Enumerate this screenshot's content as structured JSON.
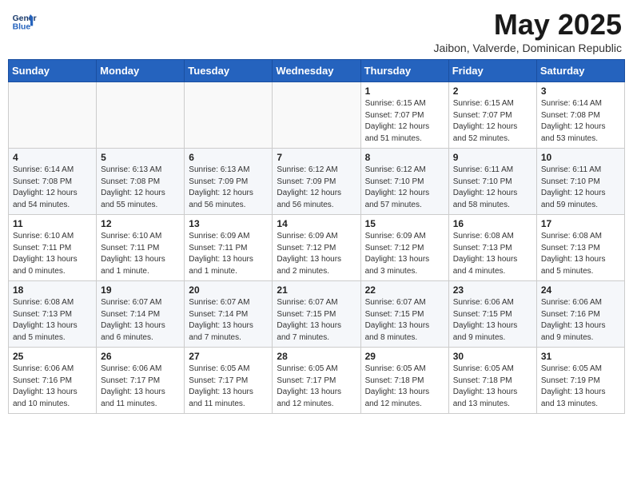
{
  "header": {
    "logo_line1": "General",
    "logo_line2": "Blue",
    "month_title": "May 2025",
    "subtitle": "Jaibon, Valverde, Dominican Republic"
  },
  "weekdays": [
    "Sunday",
    "Monday",
    "Tuesday",
    "Wednesday",
    "Thursday",
    "Friday",
    "Saturday"
  ],
  "weeks": [
    [
      {
        "day": "",
        "info": ""
      },
      {
        "day": "",
        "info": ""
      },
      {
        "day": "",
        "info": ""
      },
      {
        "day": "",
        "info": ""
      },
      {
        "day": "1",
        "info": "Sunrise: 6:15 AM\nSunset: 7:07 PM\nDaylight: 12 hours\nand 51 minutes."
      },
      {
        "day": "2",
        "info": "Sunrise: 6:15 AM\nSunset: 7:07 PM\nDaylight: 12 hours\nand 52 minutes."
      },
      {
        "day": "3",
        "info": "Sunrise: 6:14 AM\nSunset: 7:08 PM\nDaylight: 12 hours\nand 53 minutes."
      }
    ],
    [
      {
        "day": "4",
        "info": "Sunrise: 6:14 AM\nSunset: 7:08 PM\nDaylight: 12 hours\nand 54 minutes."
      },
      {
        "day": "5",
        "info": "Sunrise: 6:13 AM\nSunset: 7:08 PM\nDaylight: 12 hours\nand 55 minutes."
      },
      {
        "day": "6",
        "info": "Sunrise: 6:13 AM\nSunset: 7:09 PM\nDaylight: 12 hours\nand 56 minutes."
      },
      {
        "day": "7",
        "info": "Sunrise: 6:12 AM\nSunset: 7:09 PM\nDaylight: 12 hours\nand 56 minutes."
      },
      {
        "day": "8",
        "info": "Sunrise: 6:12 AM\nSunset: 7:10 PM\nDaylight: 12 hours\nand 57 minutes."
      },
      {
        "day": "9",
        "info": "Sunrise: 6:11 AM\nSunset: 7:10 PM\nDaylight: 12 hours\nand 58 minutes."
      },
      {
        "day": "10",
        "info": "Sunrise: 6:11 AM\nSunset: 7:10 PM\nDaylight: 12 hours\nand 59 minutes."
      }
    ],
    [
      {
        "day": "11",
        "info": "Sunrise: 6:10 AM\nSunset: 7:11 PM\nDaylight: 13 hours\nand 0 minutes."
      },
      {
        "day": "12",
        "info": "Sunrise: 6:10 AM\nSunset: 7:11 PM\nDaylight: 13 hours\nand 1 minute."
      },
      {
        "day": "13",
        "info": "Sunrise: 6:09 AM\nSunset: 7:11 PM\nDaylight: 13 hours\nand 1 minute."
      },
      {
        "day": "14",
        "info": "Sunrise: 6:09 AM\nSunset: 7:12 PM\nDaylight: 13 hours\nand 2 minutes."
      },
      {
        "day": "15",
        "info": "Sunrise: 6:09 AM\nSunset: 7:12 PM\nDaylight: 13 hours\nand 3 minutes."
      },
      {
        "day": "16",
        "info": "Sunrise: 6:08 AM\nSunset: 7:13 PM\nDaylight: 13 hours\nand 4 minutes."
      },
      {
        "day": "17",
        "info": "Sunrise: 6:08 AM\nSunset: 7:13 PM\nDaylight: 13 hours\nand 5 minutes."
      }
    ],
    [
      {
        "day": "18",
        "info": "Sunrise: 6:08 AM\nSunset: 7:13 PM\nDaylight: 13 hours\nand 5 minutes."
      },
      {
        "day": "19",
        "info": "Sunrise: 6:07 AM\nSunset: 7:14 PM\nDaylight: 13 hours\nand 6 minutes."
      },
      {
        "day": "20",
        "info": "Sunrise: 6:07 AM\nSunset: 7:14 PM\nDaylight: 13 hours\nand 7 minutes."
      },
      {
        "day": "21",
        "info": "Sunrise: 6:07 AM\nSunset: 7:15 PM\nDaylight: 13 hours\nand 7 minutes."
      },
      {
        "day": "22",
        "info": "Sunrise: 6:07 AM\nSunset: 7:15 PM\nDaylight: 13 hours\nand 8 minutes."
      },
      {
        "day": "23",
        "info": "Sunrise: 6:06 AM\nSunset: 7:15 PM\nDaylight: 13 hours\nand 9 minutes."
      },
      {
        "day": "24",
        "info": "Sunrise: 6:06 AM\nSunset: 7:16 PM\nDaylight: 13 hours\nand 9 minutes."
      }
    ],
    [
      {
        "day": "25",
        "info": "Sunrise: 6:06 AM\nSunset: 7:16 PM\nDaylight: 13 hours\nand 10 minutes."
      },
      {
        "day": "26",
        "info": "Sunrise: 6:06 AM\nSunset: 7:17 PM\nDaylight: 13 hours\nand 11 minutes."
      },
      {
        "day": "27",
        "info": "Sunrise: 6:05 AM\nSunset: 7:17 PM\nDaylight: 13 hours\nand 11 minutes."
      },
      {
        "day": "28",
        "info": "Sunrise: 6:05 AM\nSunset: 7:17 PM\nDaylight: 13 hours\nand 12 minutes."
      },
      {
        "day": "29",
        "info": "Sunrise: 6:05 AM\nSunset: 7:18 PM\nDaylight: 13 hours\nand 12 minutes."
      },
      {
        "day": "30",
        "info": "Sunrise: 6:05 AM\nSunset: 7:18 PM\nDaylight: 13 hours\nand 13 minutes."
      },
      {
        "day": "31",
        "info": "Sunrise: 6:05 AM\nSunset: 7:19 PM\nDaylight: 13 hours\nand 13 minutes."
      }
    ]
  ]
}
